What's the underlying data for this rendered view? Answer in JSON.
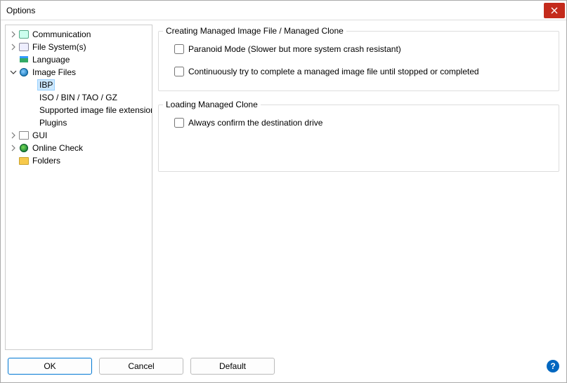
{
  "window": {
    "title": "Options"
  },
  "tree": {
    "items": [
      {
        "label": "Communication",
        "icon": "comm"
      },
      {
        "label": "File System(s)",
        "icon": "drive"
      },
      {
        "label": "Language",
        "icon": "flag"
      },
      {
        "label": "Image Files",
        "icon": "disc",
        "expanded": true
      },
      {
        "label": "IBP",
        "selected": true
      },
      {
        "label": "ISO / BIN / TAO / GZ"
      },
      {
        "label": "Supported image file extension"
      },
      {
        "label": "Plugins"
      },
      {
        "label": "GUI",
        "icon": "gui"
      },
      {
        "label": "Online Check",
        "icon": "globe"
      },
      {
        "label": "Folders",
        "icon": "folder"
      }
    ]
  },
  "groups": {
    "creating": {
      "legend": "Creating Managed Image File / Managed Clone",
      "paranoid_label": "Paranoid Mode (Slower but more system crash resistant)",
      "retry_label": "Continuously try to complete a managed image file until stopped or completed"
    },
    "loading": {
      "legend": "Loading Managed Clone",
      "confirm_label": "Always confirm the destination drive"
    }
  },
  "buttons": {
    "ok": "OK",
    "cancel": "Cancel",
    "default": "Default"
  }
}
